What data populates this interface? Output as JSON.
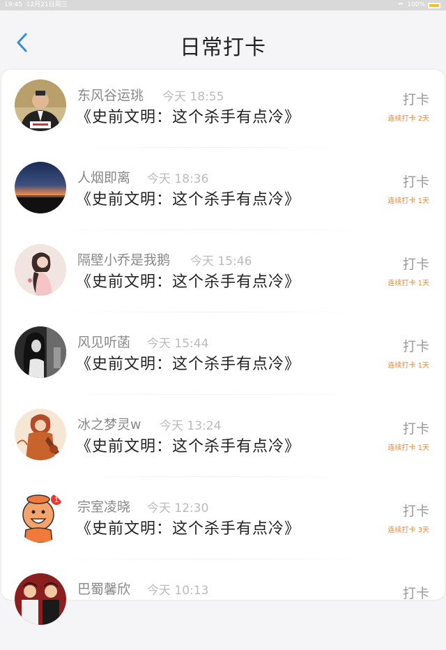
{
  "status_bar": {
    "time": "19:45",
    "date": "12月21日周三",
    "battery": "100%",
    "battery_level": 1.0
  },
  "header": {
    "title": "日常打卡",
    "back_icon": "chevron-left-icon"
  },
  "colors": {
    "accent": "#2f8ee8",
    "streak": "#f0853b"
  },
  "items": [
    {
      "name": "东风谷运珧",
      "time": "今天 18:55",
      "book": "《史前文明：这个杀手有点冷》",
      "action": "打卡",
      "streak": "连续打卡 2天"
    },
    {
      "name": "人烟即离",
      "time": "今天 18:36",
      "book": "《史前文明：这个杀手有点冷》",
      "action": "打卡",
      "streak": "连续打卡 1天"
    },
    {
      "name": "隔壁小乔是我鹅",
      "time": "今天 15:46",
      "book": "《史前文明：这个杀手有点冷》",
      "action": "打卡",
      "streak": "连续打卡 1天"
    },
    {
      "name": "风见听菡",
      "time": "今天 15:44",
      "book": "《史前文明：这个杀手有点冷》",
      "action": "打卡",
      "streak": "连续打卡 1天"
    },
    {
      "name": "冰之梦灵w",
      "time": "今天 13:24",
      "book": "《史前文明：这个杀手有点冷》",
      "action": "打卡",
      "streak": "连续打卡 1天"
    },
    {
      "name": "宗室凌晓",
      "time": "今天 12:30",
      "book": "《史前文明：这个杀手有点冷》",
      "action": "打卡",
      "streak": "连续打卡 3天"
    },
    {
      "name": "巴蜀馨欣",
      "time": "今天 10:13",
      "book": "",
      "action": "打卡",
      "streak": ""
    }
  ]
}
